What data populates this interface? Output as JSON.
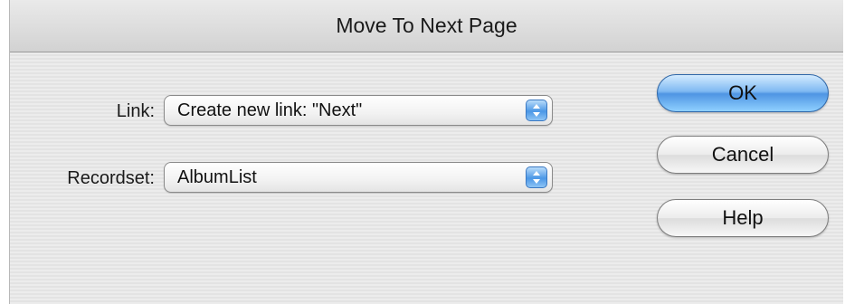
{
  "window": {
    "title": "Move To Next Page"
  },
  "form": {
    "link": {
      "label": "Link:",
      "value": "Create new link: \"Next\""
    },
    "recordset": {
      "label": "Recordset:",
      "value": "AlbumList"
    }
  },
  "buttons": {
    "ok": "OK",
    "cancel": "Cancel",
    "help": "Help"
  },
  "colors": {
    "accent": "#4f95e3"
  }
}
